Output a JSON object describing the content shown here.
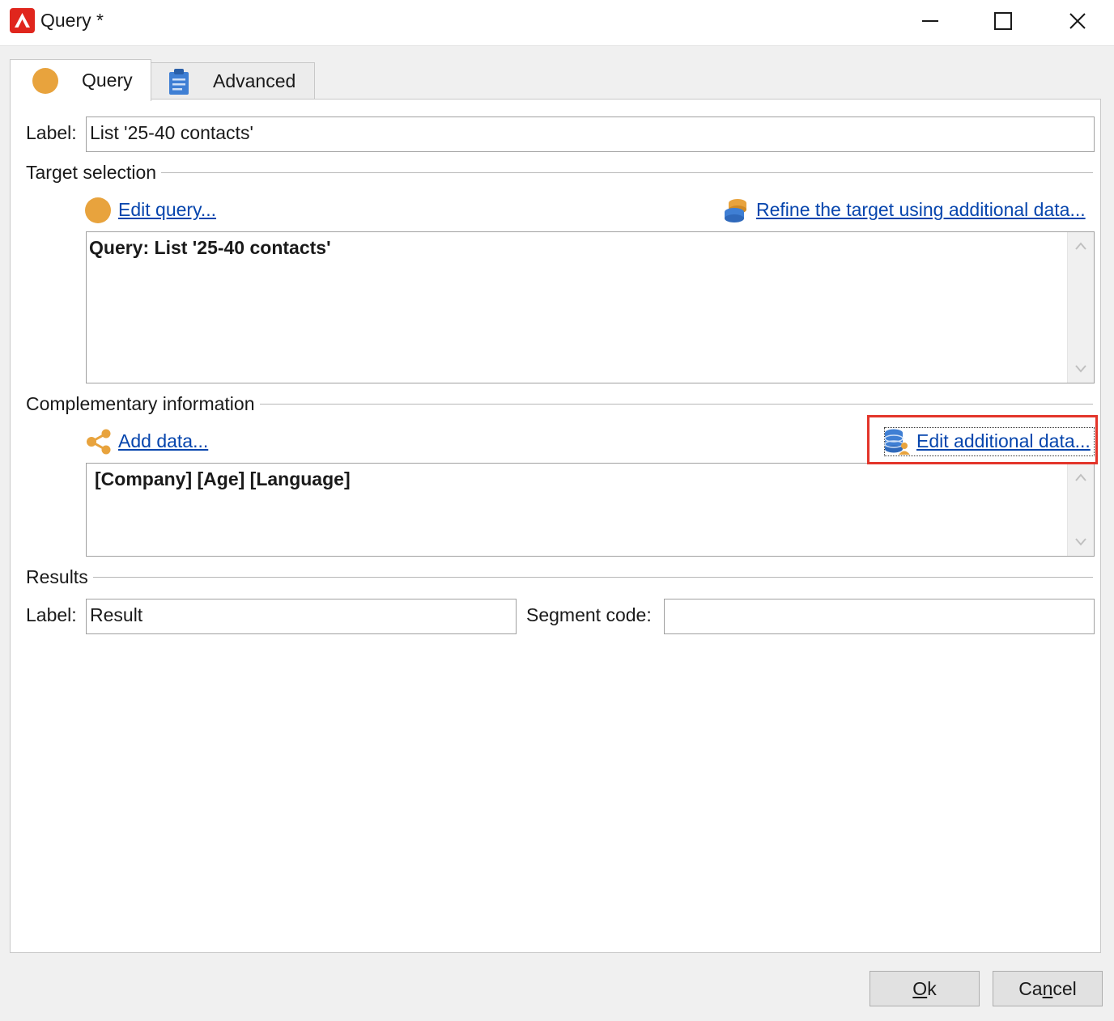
{
  "window": {
    "title": "Query *",
    "controls": {
      "minimize": "minimize",
      "maximize": "maximize",
      "close": "close"
    }
  },
  "tabs": [
    {
      "label": "Query",
      "icon": "orange-circle-icon",
      "active": true
    },
    {
      "label": "Advanced",
      "icon": "clipboard-icon",
      "active": false
    }
  ],
  "form": {
    "label_caption": "Label:",
    "label_value": "List '25-40 contacts'"
  },
  "target_selection": {
    "title": "Target selection",
    "edit_query_link": "Edit query...",
    "refine_link": "Refine the target using additional data...",
    "query_text": "Query: List '25-40 contacts'"
  },
  "complementary": {
    "title": "Complementary information",
    "add_data_link": "Add data...",
    "edit_additional_link": "Edit additional data...",
    "fields_text": "[Company]  [Age]  [Language]"
  },
  "results": {
    "title": "Results",
    "label_caption": "Label:",
    "label_value": "Result",
    "segment_caption": "Segment code:",
    "segment_value": ""
  },
  "buttons": {
    "ok_mnemonic": "O",
    "ok_rest": "k",
    "cancel_pre": "Ca",
    "cancel_mnemonic": "n",
    "cancel_rest": "cel"
  },
  "colors": {
    "accent_orange": "#e8a33d",
    "link_blue": "#0645ad",
    "highlight_red": "#e3352a",
    "app_red": "#e0261d"
  }
}
